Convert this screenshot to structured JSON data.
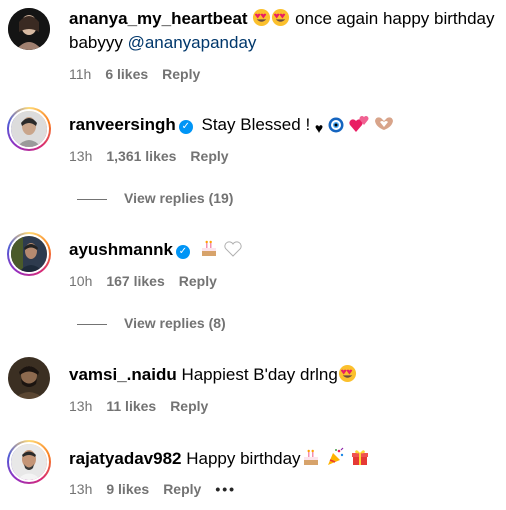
{
  "comments": [
    {
      "username": "ananya_my_heartbeat",
      "text_line1": "once again happy birthday",
      "text_line2": "babyyy ",
      "mention": "@ananyapanday",
      "time": "11h",
      "likes": "6 likes",
      "reply": "Reply"
    },
    {
      "username": "ranveersingh",
      "verified": true,
      "text": "Stay Blessed ! ",
      "time": "13h",
      "likes": "1,361 likes",
      "reply": "Reply",
      "view_replies": "View replies (19)"
    },
    {
      "username": "ayushmannk",
      "verified": true,
      "time": "10h",
      "likes": "167 likes",
      "reply": "Reply",
      "view_replies": "View replies (8)"
    },
    {
      "username": "vamsi_.naidu",
      "text": "Happiest B'day drlng",
      "time": "13h",
      "likes": "11 likes",
      "reply": "Reply"
    },
    {
      "username": "rajatyadav982",
      "text": "Happy birthday",
      "time": "13h",
      "likes": "9 likes",
      "reply": "Reply",
      "more": "•••"
    }
  ],
  "icons": {
    "verified": "verified-badge-icon",
    "heart_eyes": "heart-eyes-emoji",
    "black_heart": "black-heart-emoji",
    "nazar": "nazar-amulet-emoji",
    "two_hearts": "two-hearts-emoji",
    "heart_hands": "heart-hands-emoji",
    "cake": "birthday-cake-emoji",
    "white_heart": "white-heart-emoji",
    "party": "party-popper-emoji",
    "gift": "gift-emoji"
  },
  "colors": {
    "link": "#00376b",
    "verified": "#0095f6",
    "meta": "#737373"
  }
}
